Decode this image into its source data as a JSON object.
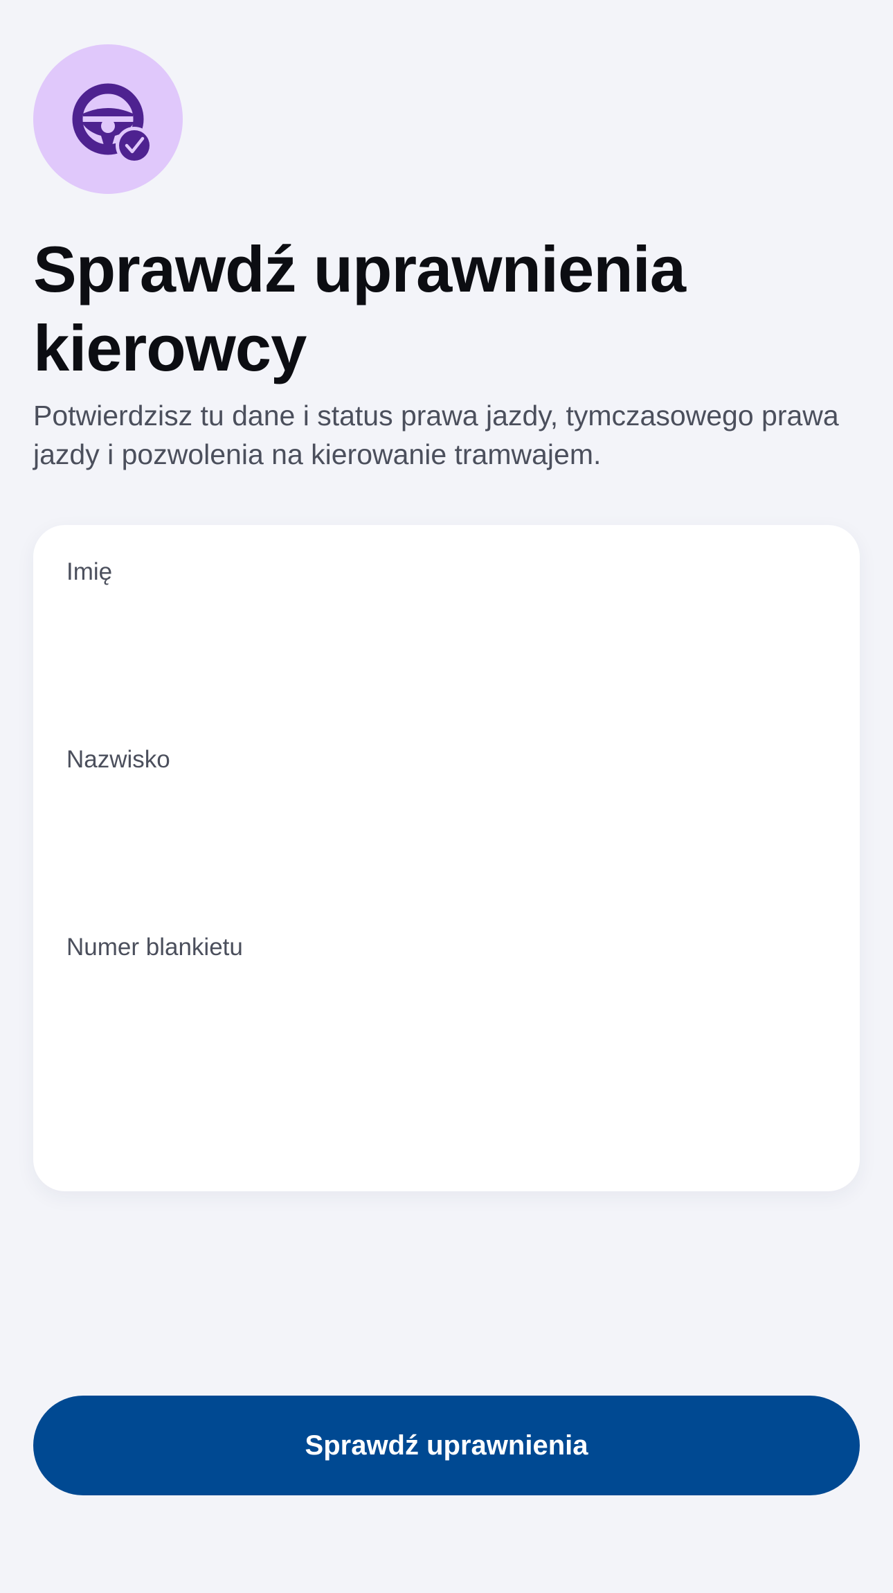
{
  "header": {
    "icon": "steering-wheel-check-icon",
    "title": "Sprawdź uprawnienia kierowcy",
    "subtitle": "Potwierdzisz tu dane i status prawa jazdy, tymczasowego prawa jazdy i pozwolenia na kierowanie tramwajem."
  },
  "form": {
    "fields": [
      {
        "label": "Imię",
        "value": ""
      },
      {
        "label": "Nazwisko",
        "value": ""
      },
      {
        "label": "Numer blankietu",
        "value": ""
      }
    ]
  },
  "actions": {
    "submit_label": "Sprawdź uprawnienia"
  },
  "colors": {
    "background": "#f3f4f9",
    "icon_circle": "#e0c8fb",
    "icon_fg": "#4e2290",
    "primary_button": "#004992",
    "title_text": "#0c0d12",
    "secondary_text": "#4b4f5c"
  }
}
